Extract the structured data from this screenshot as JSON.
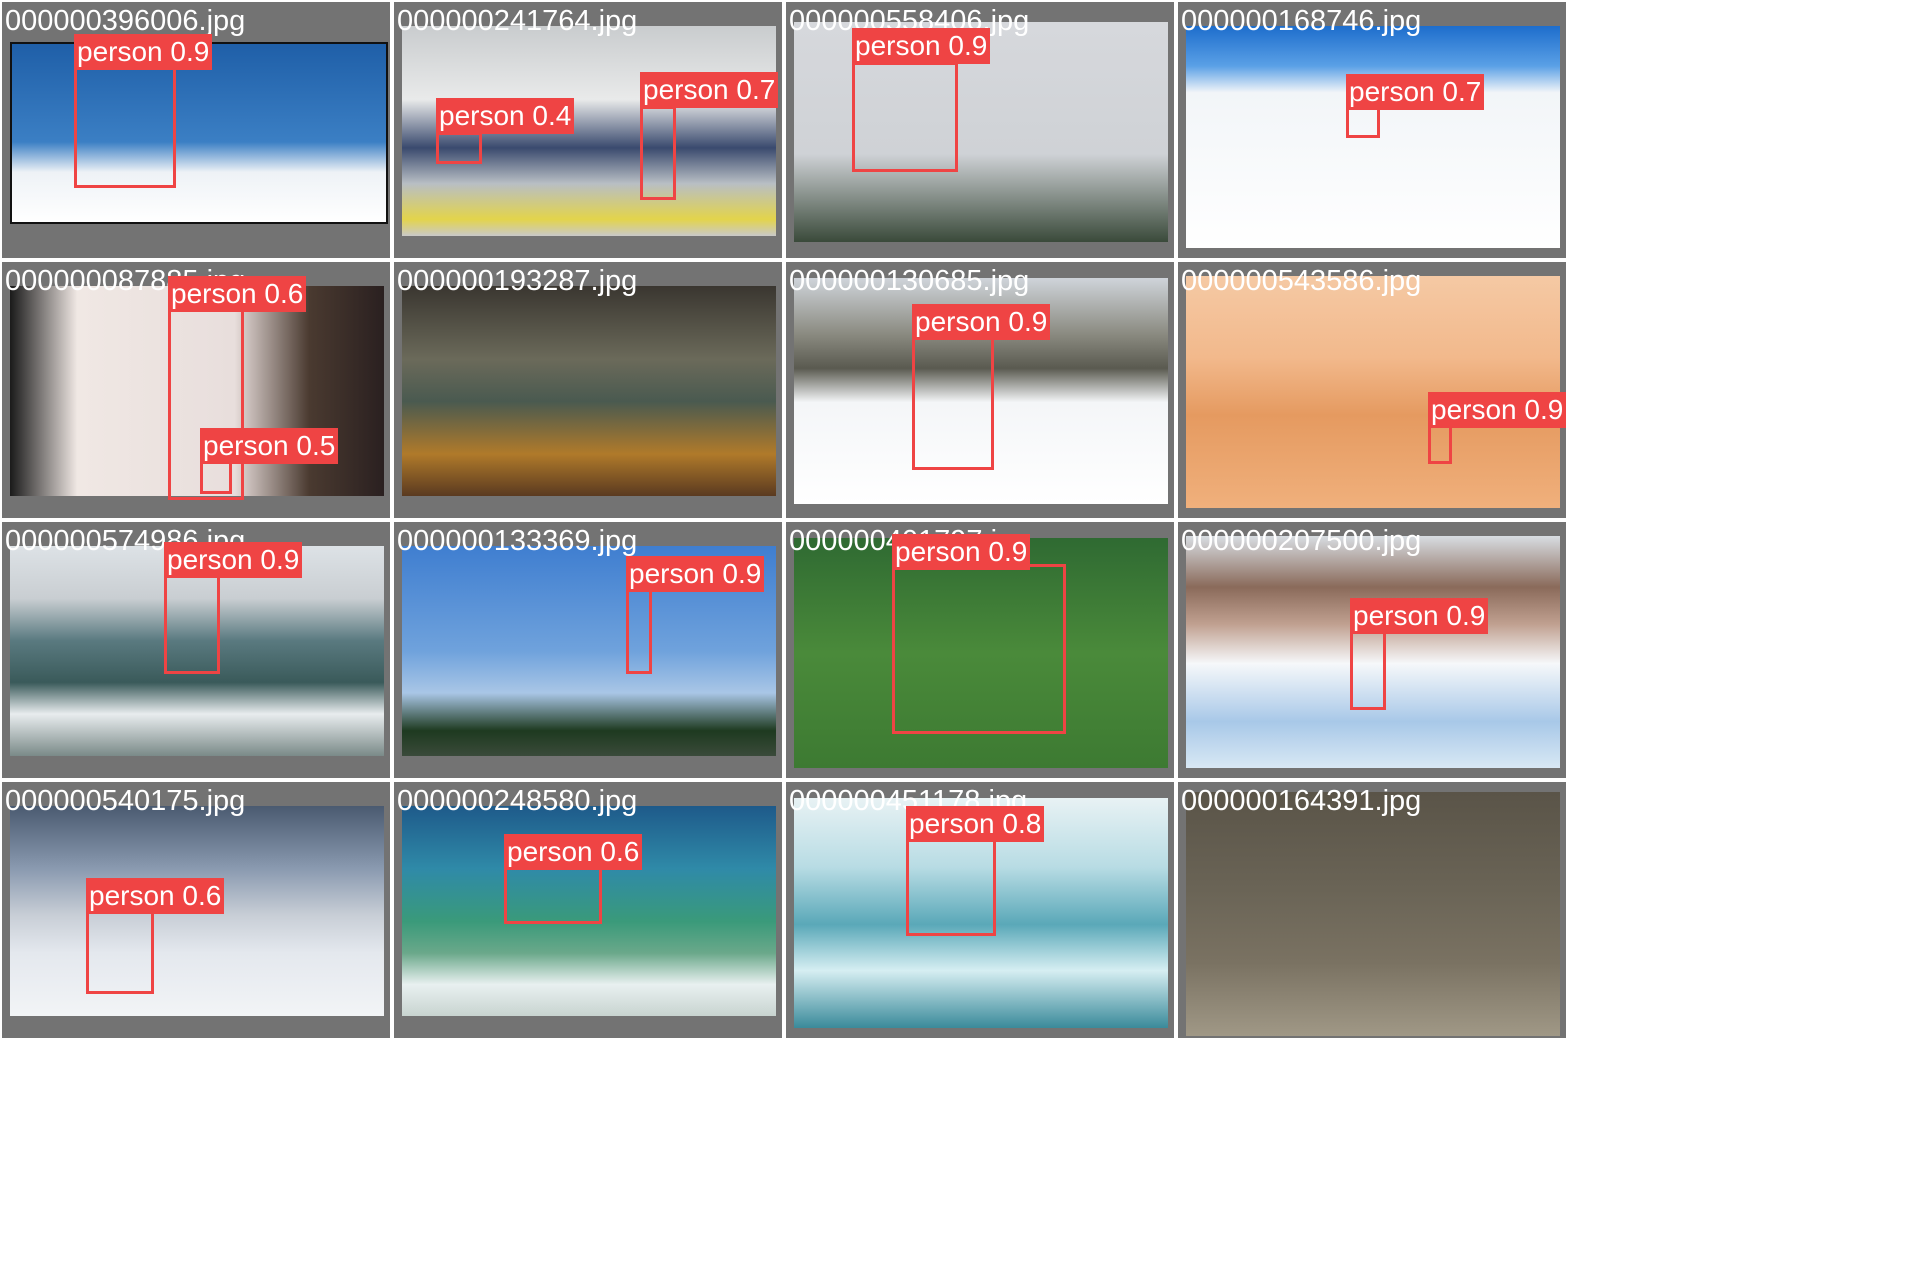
{
  "tiles": [
    {
      "file": "000000396006.jpg",
      "bg": "linear-gradient(180deg,#1f5fa8 0%,#3b7fc4 55%,#eef2f6 72%,#ffffff 100%)",
      "boxes": [
        {
          "label": "person 0.9"
        }
      ]
    },
    {
      "file": "000000241764.jpg",
      "bg": "linear-gradient(180deg,#c9ccce 0%,#e9eaea 35%,#3a4a6e 58%,#b8bec4 75%,#e3d44b 92%,#c9c9c9 100%)",
      "boxes": [
        {
          "label": "person 0.4"
        },
        {
          "label": "person 0.7"
        }
      ]
    },
    {
      "file": "000000558406.jpg",
      "bg": "linear-gradient(180deg,#d6d8dc 0%,#cfd2d6 60%,#3a4a3a 100%)",
      "boxes": [
        {
          "label": "person 0.9"
        }
      ]
    },
    {
      "file": "000000168746.jpg",
      "bg": "linear-gradient(180deg,#1d6dcc 0%,#5aa0e6 18%,#f2f5f8 30%,#ffffff 100%)",
      "boxes": [
        {
          "label": "person 0.7"
        }
      ]
    },
    {
      "file": "000000087885.jpg",
      "bg": "linear-gradient(90deg,#1a1a1a 0%,#f0e8e4 18%,#e8dedc 60%,#4a3a30 80%,#2a2020 100%)",
      "boxes": [
        {
          "label": "person 0.6"
        },
        {
          "label": "person 0.5"
        }
      ]
    },
    {
      "file": "000000193287.jpg",
      "bg": "linear-gradient(180deg,#3a3630 0%,#6b6a5a 35%,#4a5a50 55%,#b07a2a 80%,#5a3a20 100%)",
      "boxes": []
    },
    {
      "file": "000000130685.jpg",
      "bg": "linear-gradient(180deg,#cfd4da 0%,#8a8a80 25%,#5a5a50 40%,#f4f6f8 55%,#ffffff 100%)",
      "boxes": [
        {
          "label": "person 0.9"
        }
      ]
    },
    {
      "file": "000000543586.jpg",
      "bg": "linear-gradient(180deg,#f5c9a4 0%,#f2b98c 35%,#e59a60 60%,#f0b07c 100%)",
      "boxes": [
        {
          "label": "person 0.9"
        }
      ]
    },
    {
      "file": "000000574986.jpg",
      "bg": "linear-gradient(180deg,#dde2e6 0%,#c9ced2 25%,#5a7a80 45%,#3a5a5a 65%,#e8ecee 80%,#7a8a88 100%)",
      "boxes": [
        {
          "label": "person 0.9"
        }
      ]
    },
    {
      "file": "000000133369.jpg",
      "bg": "linear-gradient(180deg,#3f7ed0 0%,#6fa2dc 50%,#a9c6e6 70%,#1e3a20 88%,#3a4a3a 100%)",
      "boxes": [
        {
          "label": "person 0.9"
        }
      ]
    },
    {
      "file": "000000401797.jpg",
      "bg": "linear-gradient(180deg,#2f6a32 0%,#4a8a3a 50%,#3d7a32 100%)",
      "boxes": [
        {
          "label": "person 0.9"
        }
      ]
    },
    {
      "file": "000000207500.jpg",
      "bg": "linear-gradient(180deg,#d8dde2 0%,#8a6a5a 22%,#c0a090 38%,#f6f8fa 55%,#a8c8e8 80%,#d8e8f4 100%)",
      "boxes": [
        {
          "label": "person 0.9"
        }
      ]
    },
    {
      "file": "000000540175.jpg",
      "bg": "linear-gradient(180deg,#4a5a70 0%,#8a9ab0 30%,#c8ced6 52%,#e4e8ee 70%,#f2f4f6 100%)",
      "boxes": [
        {
          "label": "person 0.6"
        }
      ]
    },
    {
      "file": "000000248580.jpg",
      "bg": "linear-gradient(180deg,#1e5a8a 0%,#2f8aa8 30%,#3a9a7a 55%,#6aa88a 70%,#e8f0f0 85%,#c8d4d0 100%)",
      "boxes": [
        {
          "label": "person 0.6"
        }
      ]
    },
    {
      "file": "000000451178.jpg",
      "bg": "linear-gradient(180deg,#e8f2f4 0%,#b8dce4 30%,#5aa8b8 55%,#d6eef2 75%,#3a8a9a 100%)",
      "boxes": [
        {
          "label": "person 0.8"
        }
      ]
    },
    {
      "file": "000000164391.jpg",
      "bg": "linear-gradient(180deg,#5a5448 0%,#6a6456 40%,#7a7262 70%,#a09886 100%)",
      "boxes": []
    }
  ],
  "colors": {
    "box": "#ef4444",
    "tile_bg": "#737373",
    "text": "#ffffff"
  }
}
